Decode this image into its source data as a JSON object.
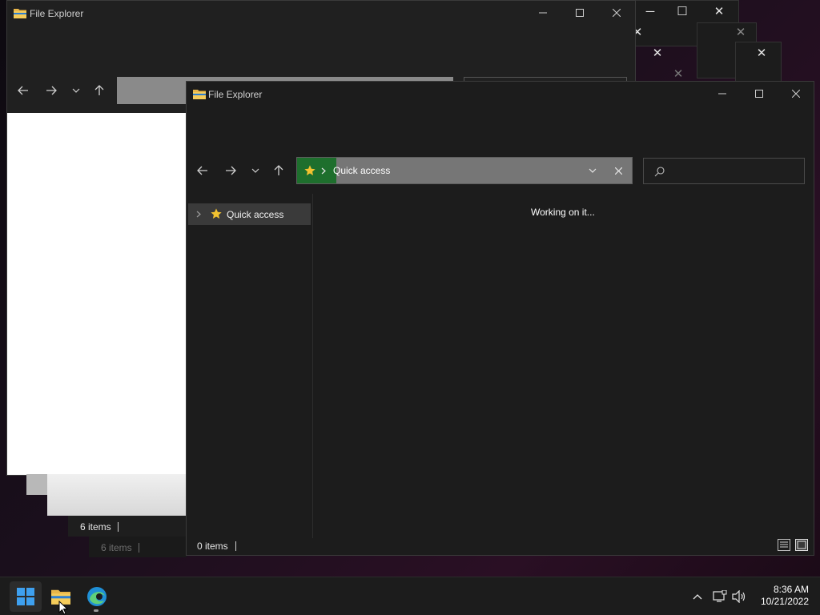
{
  "windows": {
    "back": {
      "title": "File Explorer",
      "status": "6 items",
      "status_ghost": "6 items"
    },
    "front": {
      "title": "File Explorer",
      "address": {
        "location": "Quick access",
        "dropdown_icon": "chevron-down-icon",
        "clear_icon": "close-icon"
      },
      "search": {
        "placeholder": ""
      },
      "sidebar": {
        "items": [
          {
            "label": "Quick access",
            "icon": "star-icon"
          }
        ]
      },
      "main": {
        "message": "Working on it..."
      },
      "status": "0 items"
    }
  },
  "taskbar": {
    "time": "8:36 AM",
    "date": "10/21/2022",
    "apps": [
      "start",
      "file-explorer",
      "edge"
    ]
  },
  "colors": {
    "window_bg": "#202020",
    "address_accent": "#1e6f2d",
    "address_bg": "#767676",
    "taskbar_bg": "#1c1c1c"
  }
}
